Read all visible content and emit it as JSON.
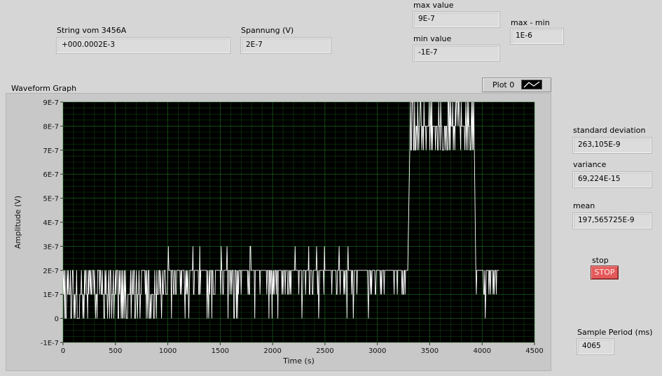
{
  "controls": {
    "string_label": "String vom 3456A",
    "string_value": "+000.0002E-3",
    "voltage_label": "Spannung (V)",
    "voltage_value": "2E-7",
    "max_label": "max value",
    "max_value": "9E-7",
    "min_label": "min value",
    "min_value": "-1E-7",
    "range_label": "max - min",
    "range_value": "1E-6",
    "std_label": "standard deviation",
    "std_value": "263,105E-9",
    "variance_label": "variance",
    "variance_value": "69,224E-15",
    "mean_label": "mean",
    "mean_value": "197,565725E-9",
    "stop_label": "stop",
    "stop_button": "STOP",
    "period_label": "Sample Period (ms)",
    "period_value": "4065"
  },
  "graph": {
    "title": "Waveform Graph",
    "legend_label": "Plot 0"
  },
  "chart_data": {
    "type": "line",
    "title": "Waveform Graph",
    "xlabel": "Time (s)",
    "ylabel": "Amplitude (V)",
    "xlim": [
      0,
      4500
    ],
    "ylim": [
      -1e-07,
      9e-07
    ],
    "x_ticks": [
      "0",
      "500",
      "1000",
      "1500",
      "2000",
      "2500",
      "3000",
      "3500",
      "4000",
      "4500"
    ],
    "y_ticks": [
      "-1E-7",
      "0",
      "1E-7",
      "2E-7",
      "3E-7",
      "4E-7",
      "5E-7",
      "6E-7",
      "7E-7",
      "8E-7",
      "9E-7"
    ],
    "grid": true,
    "legend": "top-right",
    "colors": {
      "plot_bg": "#000000",
      "grid": "#1f7a1f",
      "trace": "#ffffff"
    },
    "series": [
      {
        "name": "Plot 0",
        "segments": [
          {
            "x_start": 0,
            "x_end": 1000,
            "level": 1e-07,
            "low": 0,
            "high": 2e-07
          },
          {
            "x_start": 1000,
            "x_end": 3290,
            "level": 1.5e-07,
            "low": 0,
            "high": 3e-07
          },
          {
            "x_start": 3310,
            "x_end": 3920,
            "level": 8e-07,
            "low": 7e-07,
            "high": 9e-07
          },
          {
            "x_start": 3940,
            "x_end": 4160,
            "level": 1.5e-07,
            "low": 0,
            "high": 2e-07
          }
        ]
      }
    ]
  }
}
